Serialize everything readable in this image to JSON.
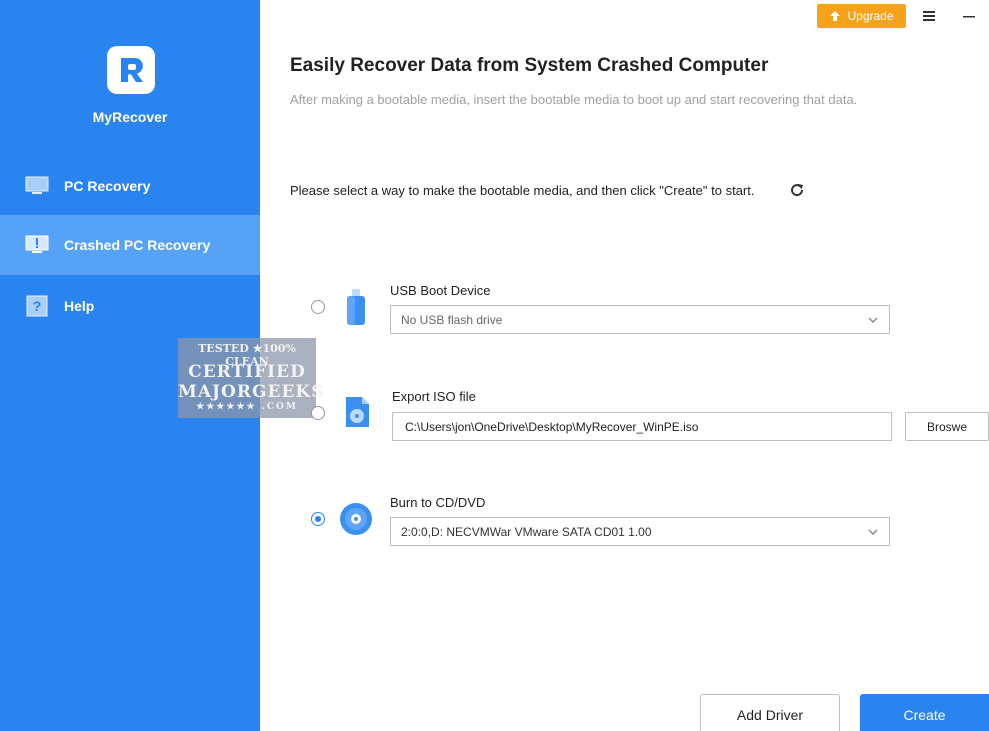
{
  "app": {
    "name": "MyRecover"
  },
  "titlebar": {
    "upgrade_label": "Upgrade"
  },
  "sidebar": {
    "items": [
      {
        "label": "PC Recovery",
        "icon": "monitor-icon",
        "active": false
      },
      {
        "label": "Crashed PC Recovery",
        "icon": "monitor-warning-icon",
        "active": true
      },
      {
        "label": "Help",
        "icon": "help-icon",
        "active": false
      }
    ]
  },
  "watermark": {
    "line1": "TESTED ★100% CLEAN",
    "line2": "CERTIFIED",
    "line3": "MAJORGEEKS",
    "line4": "★★★★★★ .COM"
  },
  "main": {
    "title": "Easily Recover Data from System Crashed Computer",
    "subtitle": "After making a bootable media, insert the bootable media to boot up and start recovering that data.",
    "instruction": "Please select a way to make the bootable media, and then click \"Create\" to start.",
    "options": {
      "usb": {
        "label": "USB Boot Device",
        "select_value": "No USB flash drive",
        "selected": false
      },
      "iso": {
        "label": "Export ISO file",
        "path_value": "C:\\Users\\jon\\OneDrive\\Desktop\\MyRecover_WinPE.iso",
        "browse_label": "Broswe",
        "selected": false
      },
      "cd": {
        "label": "Burn to CD/DVD",
        "select_value": "2:0:0,D: NECVMWar VMware SATA CD01 1.00",
        "selected": true
      }
    },
    "add_driver_label": "Add Driver",
    "create_label": "Create"
  },
  "colors": {
    "accent": "#2a84f0",
    "sidebar_active": "#55a2f7",
    "upgrade": "#f7a21b"
  }
}
